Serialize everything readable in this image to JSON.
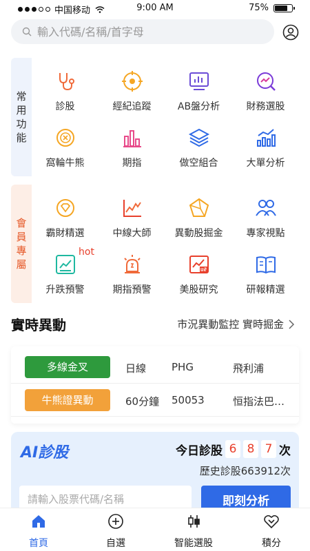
{
  "status_bar": {
    "carrier": "中国移动",
    "time": "9:00 AM",
    "battery": "75%"
  },
  "search": {
    "placeholder": "輸入代碼/名稱/首字母"
  },
  "common": {
    "side_label": [
      "常",
      "用",
      "功",
      "能"
    ],
    "items": [
      {
        "label": "診股",
        "icon": "stethoscope-icon"
      },
      {
        "label": "經紀追蹤",
        "icon": "target-icon"
      },
      {
        "label": "AB盤分析",
        "icon": "monitor-chart-icon"
      },
      {
        "label": "財務選股",
        "icon": "search-chart-icon"
      },
      {
        "label": "窩輪牛熊",
        "icon": "coin-icon"
      },
      {
        "label": "期指",
        "icon": "bar-chart-icon"
      },
      {
        "label": "做空組合",
        "icon": "layers-icon"
      },
      {
        "label": "大單分析",
        "icon": "trend-bars-icon"
      }
    ]
  },
  "member": {
    "side_label": [
      "會",
      "員",
      "專",
      "屬"
    ],
    "hot_label": "hot",
    "items": [
      {
        "label": "霸財精選",
        "icon": "diamond-icon"
      },
      {
        "label": "中線大師",
        "icon": "line-chart-icon"
      },
      {
        "label": "異動股掘金",
        "icon": "pentagon-icon"
      },
      {
        "label": "專家視點",
        "icon": "experts-icon"
      },
      {
        "label": "升跌預警",
        "icon": "alert-chart-icon"
      },
      {
        "label": "期指預警",
        "icon": "siren-icon"
      },
      {
        "label": "美股研究",
        "icon": "us-chart-icon"
      },
      {
        "label": "研報精選",
        "icon": "book-icon"
      }
    ]
  },
  "realtime": {
    "title": "實時異動",
    "links": "市況異動監控 實時掘金",
    "rows": [
      {
        "tag": "多線金叉",
        "tag_color": "#2e9a3d",
        "period": "日線",
        "code": "PHG",
        "name": "飛利浦"
      },
      {
        "tag": "牛熊證異動",
        "tag_color": "#f2a13a",
        "period": "60分鐘",
        "code": "50053",
        "name": "恒指法巴…"
      }
    ]
  },
  "ai": {
    "title": "AI診股",
    "today_label": "今日診股",
    "digits": [
      "6",
      "8",
      "7"
    ],
    "unit": "次",
    "history": "歷史診股663912次",
    "input_placeholder": "請輸入股票代碼/名稱",
    "button": "即刻分析"
  },
  "tabbar": [
    {
      "label": "首頁",
      "icon": "home-icon",
      "active": true
    },
    {
      "label": "自選",
      "icon": "plus-circle-icon",
      "active": false
    },
    {
      "label": "智能選股",
      "icon": "candlestick-icon",
      "active": false
    },
    {
      "label": "積分",
      "icon": "heart-badge-icon",
      "active": false
    }
  ],
  "colors": {
    "accent": "#2f6ae6",
    "hot": "#e8402c",
    "member_side": "#e65a2a"
  }
}
